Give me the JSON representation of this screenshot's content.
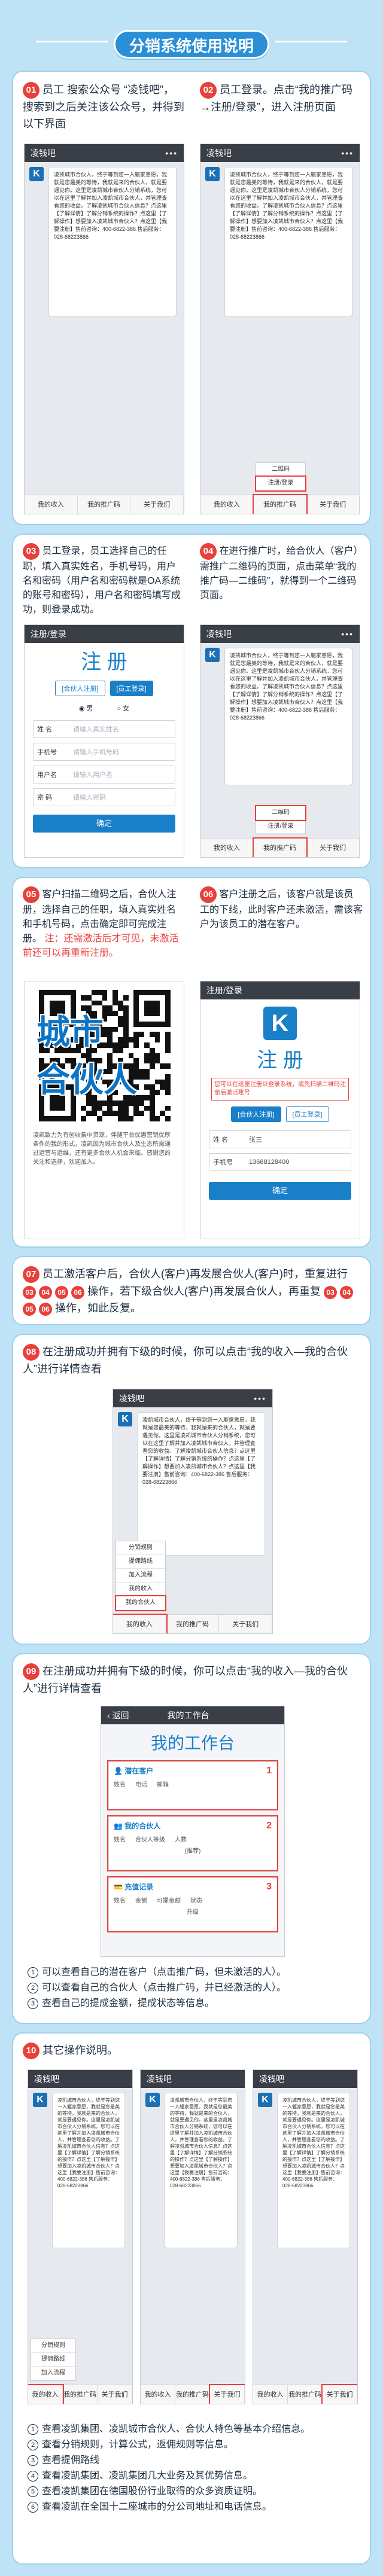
{
  "title": "分销系统使用说明",
  "step01": {
    "num": "01",
    "text": "员工 搜索公众号 “凌钱吧”，搜索到之后关注该公众号，并得到以下界面"
  },
  "step02": {
    "num": "02",
    "text": "员工登录。点击“我的推广码→注册/登录”，进入注册页面"
  },
  "step03": {
    "num": "03",
    "text": "员工登录，员工选择自己的任职，填入真实姓名，手机号码，用户名和密码（用户名和密码就是OA系统的账号和密码），用户名和密码填写成功，则登录成功。"
  },
  "step04": {
    "num": "04",
    "text": "在进行推广时，给合伙人（客户）需推广二维码的页面，点击菜单“我的推广码—二维码”，就得到一个二维码页面。"
  },
  "step05": {
    "num": "05",
    "text": "客户扫描二维码之后，合伙人注册，选择自己的任职，填入真实姓名和手机号码，点击确定即可完成注册。",
    "warn": "注：还需激活后才可见，未激活前还可以再重新注册。"
  },
  "step06": {
    "num": "06",
    "text": "客户注册之后，该客户就是该员工的下线，此时客户还未激活，需该客户为该员工的潜在客户。"
  },
  "step07": {
    "num": "07",
    "text_a": "员工激活客户后，合伙人(客户)再发展合伙人(客户)时，重复进行",
    "text_b": "操作，若下级合伙人(客户)再发展合伙人，再重复",
    "text_c": "操作，如此反复。"
  },
  "step08": {
    "num": "08",
    "text": "在注册成功并拥有下级的时候，你可以点击“我的收入—我的合伙人”进行详情查看"
  },
  "step09": {
    "num": "09",
    "text": "在注册成功并拥有下级的时候，你可以点击“我的收入—我的合伙人”进行详情查看"
  },
  "step10": {
    "num": "10",
    "text": "其它操作说明。"
  },
  "phone": {
    "account": "凌钱吧",
    "bubble": "凌凯城市合伙人，终于等到您一入躯家意愿，我就是您最美的等待，我就是来的合伙人，就是要遇见你。这里是凌凯城市合伙人分销系统，您可以在这里了解并加入凌凯城市合伙人，并管理查看您的收益。了解凌凯城市合伙人信息？点这里【了解详情】了解分销系统的操作？点这里【了解操作】想要加入凌凯城市合伙人？点这里【我要注册】售前咨询：400-6822-386 售后服务：028-68223866",
    "menu": [
      "我的收入",
      "我的推广码",
      "关于我们"
    ],
    "popup_reg": [
      "二维码",
      "注册/登录"
    ],
    "popup_income": [
      "分销规则",
      "提佣路线",
      "加入流程",
      "我的收入",
      "我的合伙人"
    ]
  },
  "register": {
    "bar": "注册/登录",
    "title": "注 册",
    "tab1": "[合伙人注册]",
    "tab2": "[员工登录]",
    "notice": "您可以在这里注册以登录系统，或先扫描二维码注册后激活账号",
    "gender_m": "男",
    "gender_f": "女",
    "name_label": "姓 名",
    "name_ph": "请输入真实姓名",
    "name_val": "张三",
    "phone_label": "手机号",
    "phone_ph": "请输入手机号码",
    "phone_val": "13688128400",
    "user_label": "用户名",
    "user_ph": "请输入用户名",
    "pwd_label": "密 码",
    "pwd_ph": "请输入密码",
    "ok": "确定"
  },
  "qr": {
    "overlay1": "城市",
    "overlay2": "合伙人",
    "caption": "凌凯致力为有创收集中资源，伴随平台优惠营销优厚条件的我的形式，凌凯因为城市合伙人及生态所需通过运营与运维，还有更多合伙人机会来临。感谢您的关注和选择，欢迎加入。"
  },
  "workbench": {
    "back": "返回",
    "header": "我的工作台",
    "title": "我的工作台",
    "s1": "潜在客户",
    "s1_cols": [
      "姓名",
      "电话",
      "邮箱"
    ],
    "s2": "我的合伙人",
    "s2_cols": [
      "姓名",
      "合伙人等级",
      "人数"
    ],
    "s2_extra": "(推荐)",
    "s3": "充值记录",
    "s3_cols": [
      "姓名",
      "金额",
      "可提金额",
      "状态"
    ],
    "s3_extra": "升级",
    "tag1": "1",
    "tag2": "2",
    "tag3": "3"
  },
  "list09": [
    "可以查看自己的潜在客户（点击推广码，但未激活的人）。",
    "可以查看自己的合伙人（点击推广码，并已经激活的人）。",
    "查看自己的提成金额，提成状态等信息。"
  ],
  "list10": [
    "查看凌凯集团、凌凯城市合伙人、合伙人特色等基本介绍信息。",
    "查看分销规则，计算公式，返佣规则等信息。",
    "查看提佣路线",
    "查看凌凯集团、凌凯集团几大业务及其优势信息。",
    "查看凌凯集团在德国股份行业取得的众多资质证明。",
    "查看凌凯在全国十二座城市的分公司地址和电话信息。"
  ],
  "circ": [
    "1",
    "2",
    "3",
    "4",
    "5",
    "6"
  ]
}
